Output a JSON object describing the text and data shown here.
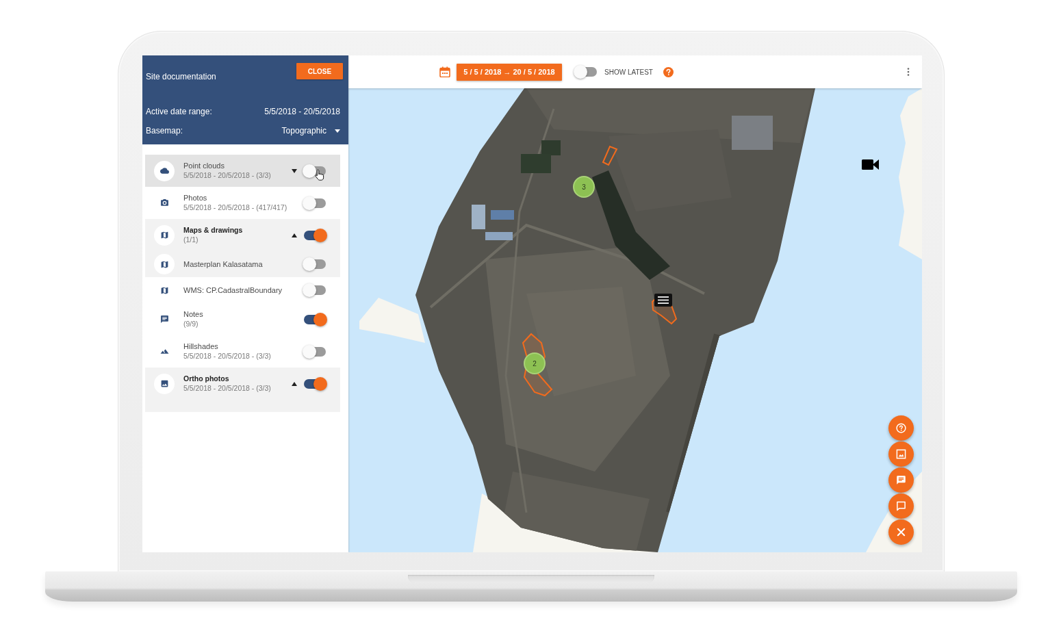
{
  "sidebar": {
    "title": "Site documentation",
    "close_button": "CLOSE",
    "date_range": {
      "label": "Active date range:",
      "value": "5/5/2018 - 20/5/2018"
    },
    "basemap": {
      "label": "Basemap:",
      "value": "Topographic"
    },
    "layers": [
      {
        "title": "Point clouds",
        "subtitle": "5/5/2018 - 20/5/2018 - (3/3)",
        "expanded": false,
        "hovered": true,
        "on": false
      },
      {
        "title": "Photos",
        "subtitle": "5/5/2018 - 20/5/2018 - (417/417)",
        "hovered": false,
        "on": false
      },
      {
        "title": "Maps & drawings",
        "subtitle": "(1/1)",
        "expanded": true,
        "hovered": false,
        "on": true,
        "children": [
          {
            "title": "Masterplan Kalasatama",
            "on": false
          }
        ]
      },
      {
        "title": "WMS: CP.CadastralBoundary",
        "hovered": false,
        "on": false
      },
      {
        "title": "Notes",
        "subtitle": "(9/9)",
        "hovered": false,
        "on": true
      },
      {
        "title": "Hillshades",
        "subtitle": "5/5/2018 - 20/5/2018 - (3/3)",
        "hovered": false,
        "on": false
      },
      {
        "title": "Ortho photos",
        "subtitle": "5/5/2018 - 20/5/2018 - (3/3)",
        "expanded": true,
        "hovered": false,
        "on": true
      }
    ]
  },
  "toolbar": {
    "date_button": "5 / 5 / 2018 → 20 / 5 / 2018",
    "show_latest": {
      "label": "SHOW LATEST",
      "on": false
    }
  },
  "map": {
    "clusters": [
      {
        "count": "3"
      },
      {
        "count": "2"
      }
    ]
  }
}
